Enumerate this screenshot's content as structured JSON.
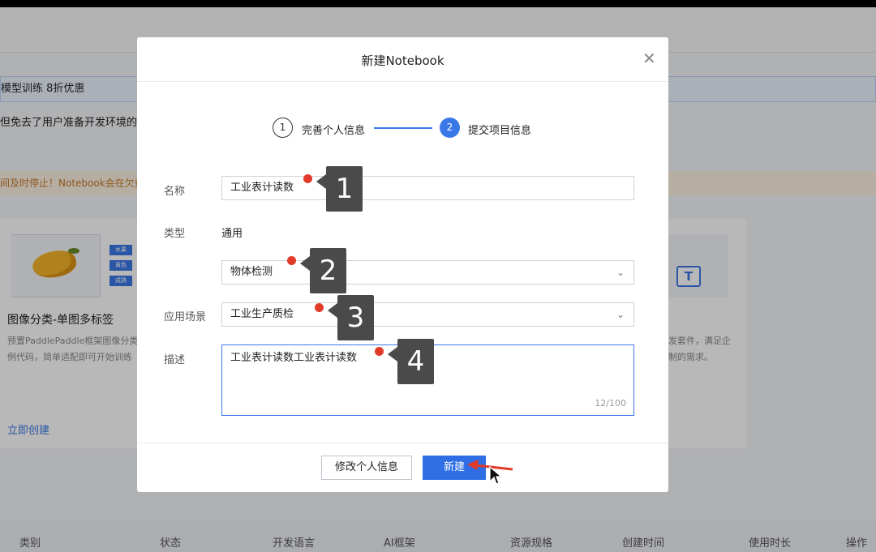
{
  "background": {
    "promo_text": "模型训练 8折优惠",
    "description_text": "但免去了用户准备开发环境的",
    "warning_text": "间及时停止！Notebook会在欠费后",
    "card": {
      "tags": [
        "水果",
        "黄色",
        "成熟"
      ],
      "title": "图像分类-单图多标签",
      "text_line1": "预置PaddlePaddle框架图像分类",
      "text_line2": "例代码，简单适配即可开始训练",
      "link": "立即创建"
    },
    "right_card": {
      "text_line1": "发套件，满足企",
      "text_line2": "制的需求。",
      "icon_glyph": "T"
    },
    "table_headers": [
      "类别",
      "状态",
      "开发语言",
      "AI框架",
      "资源规格",
      "创建时间",
      "使用时长",
      "操作"
    ]
  },
  "modal": {
    "title": "新建Notebook",
    "close_glyph": "✕",
    "steps": [
      {
        "number": "1",
        "label": "完善个人信息"
      },
      {
        "number": "2",
        "label": "提交项目信息"
      }
    ],
    "fields": {
      "name_label": "名称",
      "name_value": "工业表计读数",
      "type_label": "类型",
      "type_value": "通用",
      "subtype_value": "物体检测",
      "scene_label": "应用场景",
      "scene_value": "工业生产质检",
      "desc_label": "描述",
      "desc_value": "工业表计读数工业表计读数",
      "desc_counter": "12/100"
    },
    "chevron_glyph": "⌄",
    "buttons": {
      "edit_label": "修改个人信息",
      "create_label": "新建"
    }
  },
  "annotations": {
    "markers": [
      "1",
      "2",
      "3",
      "4"
    ],
    "dot_color": "#e23b2a",
    "arrow_color": "#e23b2a"
  },
  "colors": {
    "accent": "#2f6ee4",
    "marker_bg": "#4a4a4a",
    "warning": "#c47a2a"
  }
}
